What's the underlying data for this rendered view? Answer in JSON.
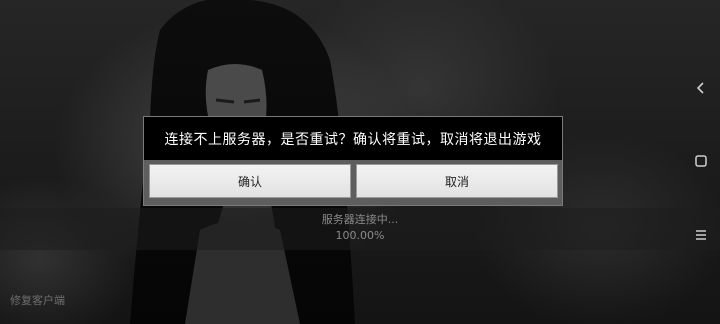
{
  "dialog": {
    "message": "连接不上服务器，是否重试？确认将重试，取消将退出游戏",
    "confirm_label": "确认",
    "cancel_label": "取消"
  },
  "loading": {
    "status": "服务器连接中...",
    "percent": "100.00%"
  },
  "footer": {
    "repair_label": "修复客户端"
  },
  "nav_bar": {
    "icons": [
      "back-icon",
      "home-icon",
      "menu-icon"
    ]
  },
  "colors": {
    "dialog_message_bg": "#000000",
    "dialog_frame": "#5e5e5e",
    "button_bg": "#ececec",
    "muted_text": "#8a8a8a"
  }
}
